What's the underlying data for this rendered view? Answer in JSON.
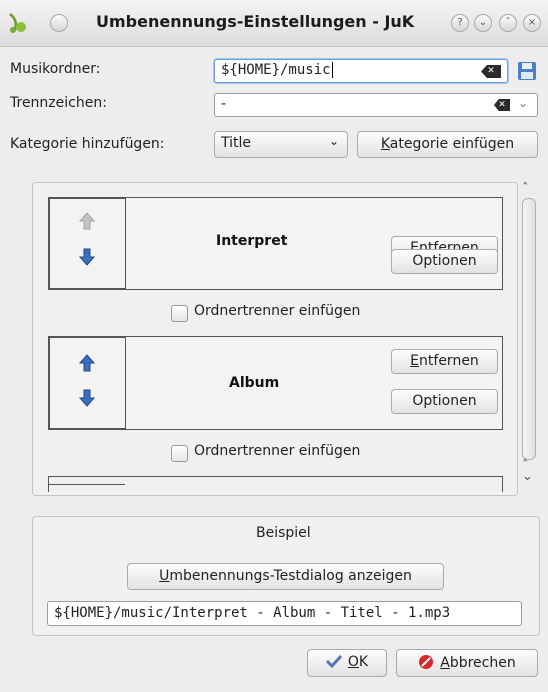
{
  "window": {
    "title": "Umbenennungs-Einstellungen - JuK",
    "buttons": [
      "help",
      "minimize",
      "maximize",
      "close"
    ]
  },
  "form": {
    "music_folder_label": "Musikordner:",
    "music_folder_value": "${HOME}/music",
    "separator_label": "Trennzeichen:",
    "separator_value": "-",
    "add_category_label": "Kategorie hinzufügen:",
    "add_category_selected": "Title",
    "insert_category_button": "Kategorie einfügen"
  },
  "categories": [
    {
      "name": "Interpret",
      "remove_label": "Entfernen",
      "options_label": "Optionen",
      "up_enabled": false,
      "down_enabled": true
    },
    {
      "name": "Album",
      "remove_label": "Entfernen",
      "options_label": "Optionen",
      "up_enabled": true,
      "down_enabled": true
    }
  ],
  "separators": [
    {
      "label": "Ordnertrenner einfügen",
      "checked": false
    },
    {
      "label": "Ordnertrenner einfügen",
      "checked": false
    }
  ],
  "example": {
    "heading": "Beispiel",
    "test_dialog_button": "Umbenennungs-Testdialog anzeigen",
    "preview": "${HOME}/music/Interpret - Album - Titel - 1.mp3"
  },
  "dialog": {
    "ok_label": "OK",
    "cancel_label": "Abbrechen"
  },
  "icons": {
    "arrow_enabled": "#3a6fc4",
    "arrow_disabled": "#bdbdbd",
    "ok_check": "#5877b8",
    "cancel_red": "#d42a2a"
  }
}
